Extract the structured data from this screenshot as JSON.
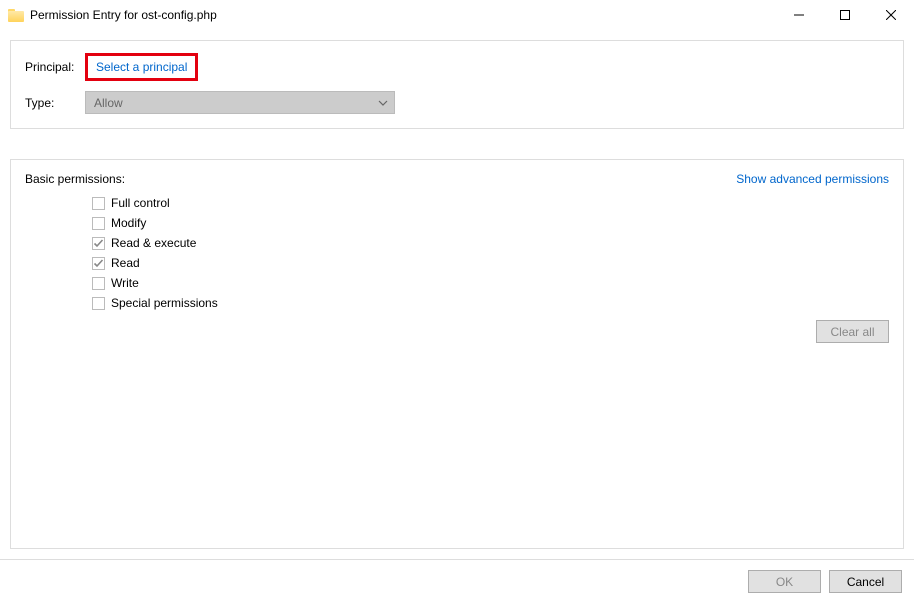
{
  "titlebar": {
    "title": "Permission Entry for ost-config.php"
  },
  "top": {
    "principal_label": "Principal:",
    "select_principal": "Select a principal",
    "type_label": "Type:",
    "type_value": "Allow"
  },
  "basic": {
    "title": "Basic permissions:",
    "advanced_link": "Show advanced permissions",
    "permissions": [
      {
        "label": "Full control",
        "checked": false,
        "disabled": true
      },
      {
        "label": "Modify",
        "checked": false,
        "disabled": true
      },
      {
        "label": "Read & execute",
        "checked": true,
        "disabled": true
      },
      {
        "label": "Read",
        "checked": true,
        "disabled": true
      },
      {
        "label": "Write",
        "checked": false,
        "disabled": true
      },
      {
        "label": "Special permissions",
        "checked": false,
        "disabled": true
      }
    ],
    "clear_all": "Clear all"
  },
  "footer": {
    "ok": "OK",
    "cancel": "Cancel"
  }
}
